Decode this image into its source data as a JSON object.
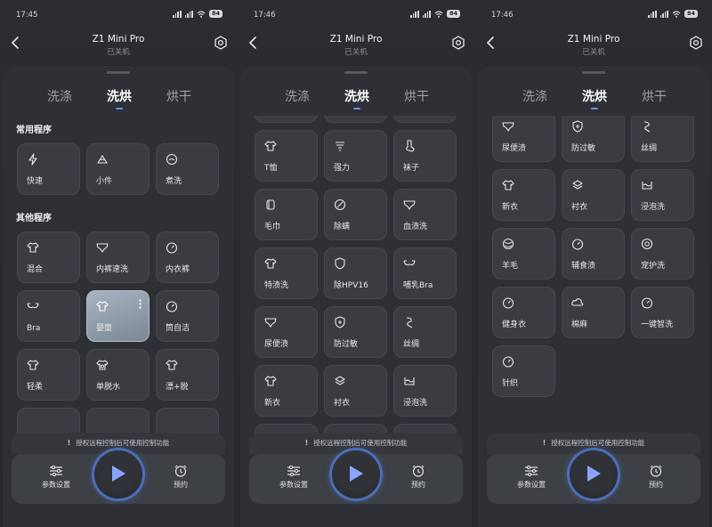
{
  "panels": [
    {
      "status_time": "17:45",
      "battery": "84",
      "title": "Z1 Mini Pro",
      "subtitle": "已关机",
      "tabs": [
        "洗涤",
        "洗烘",
        "烘干"
      ],
      "active_tab": 1,
      "sections": [
        "常用程序",
        "其他程序"
      ],
      "cards": [
        "快速",
        "小件",
        "煮洗",
        "混合",
        "内裤速洗",
        "内衣裤",
        "Bra",
        "婴童",
        "筒自洁",
        "轻柔",
        "单脱水",
        "漂+脱"
      ],
      "notice": "授权远程控制后可使用控制功能",
      "params_label": "参数设置",
      "schedule_label": "预约"
    },
    {
      "status_time": "17:46",
      "battery": "84",
      "title": "Z1 Mini Pro",
      "subtitle": "已关机",
      "tabs": [
        "洗涤",
        "洗烘",
        "烘干"
      ],
      "active_tab": 1,
      "cards": [
        "T恤",
        "强力",
        "袜子",
        "毛巾",
        "除螨",
        "血渍洗",
        "特渍洗",
        "除HPV16",
        "哺乳Bra",
        "尿便渍",
        "防过敏",
        "丝绸",
        "新衣",
        "衬衣",
        "浸泡洗"
      ],
      "notice": "授权远程控制后可使用控制功能",
      "params_label": "参数设置",
      "schedule_label": "预约"
    },
    {
      "status_time": "17:46",
      "battery": "84",
      "title": "Z1 Mini Pro",
      "subtitle": "已关机",
      "tabs": [
        "洗涤",
        "洗烘",
        "烘干"
      ],
      "active_tab": 1,
      "cards": [
        "尿便渍",
        "防过敏",
        "丝绸",
        "新衣",
        "衬衣",
        "浸泡洗",
        "羊毛",
        "辅食渍",
        "宠护洗",
        "健身衣",
        "棉麻",
        "一键智洗",
        "针织"
      ],
      "notice": "授权远程控制后可使用控制功能",
      "params_label": "参数设置",
      "schedule_label": "预约"
    }
  ],
  "colors": {
    "accent": "#6d8cf5",
    "card_bg": "#3a3c41",
    "selected_card": "#a9b4c2",
    "play_ring": "#4a6fb8"
  }
}
